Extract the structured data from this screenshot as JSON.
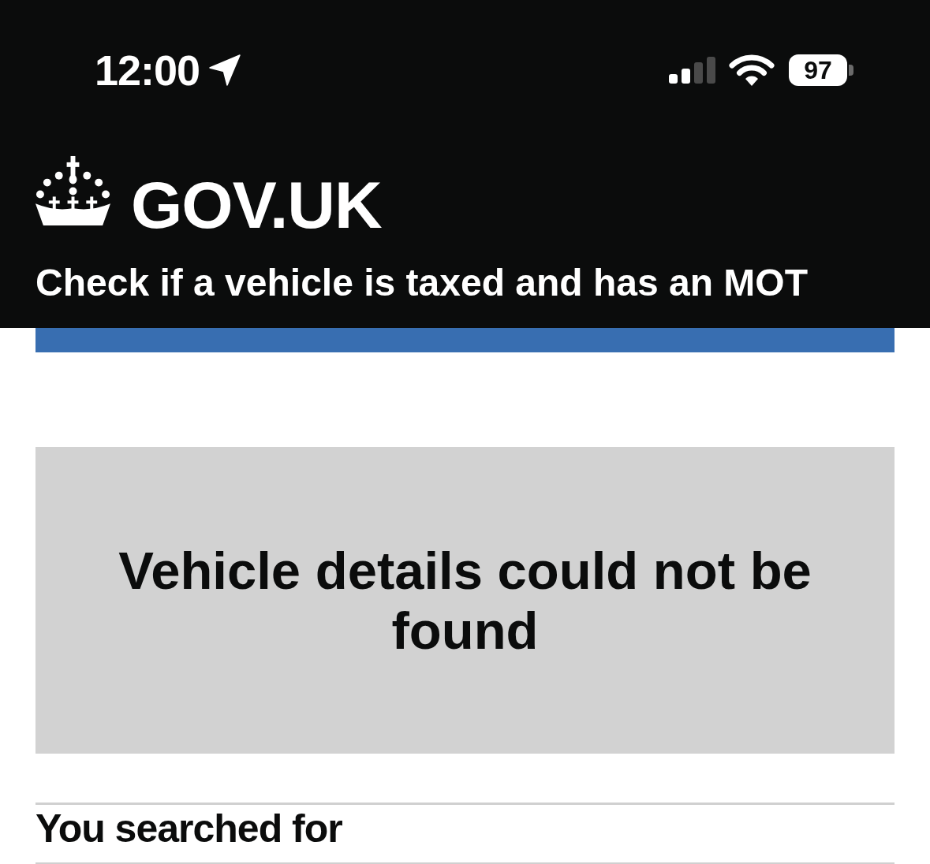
{
  "status_bar": {
    "time": "12:00",
    "battery": "97"
  },
  "header": {
    "logo": "GOV.UK",
    "service_name": "Check if a vehicle is taxed and has an MOT"
  },
  "panel": {
    "title": "Vehicle details could not be found"
  },
  "summary": {
    "key": "You searched for"
  }
}
